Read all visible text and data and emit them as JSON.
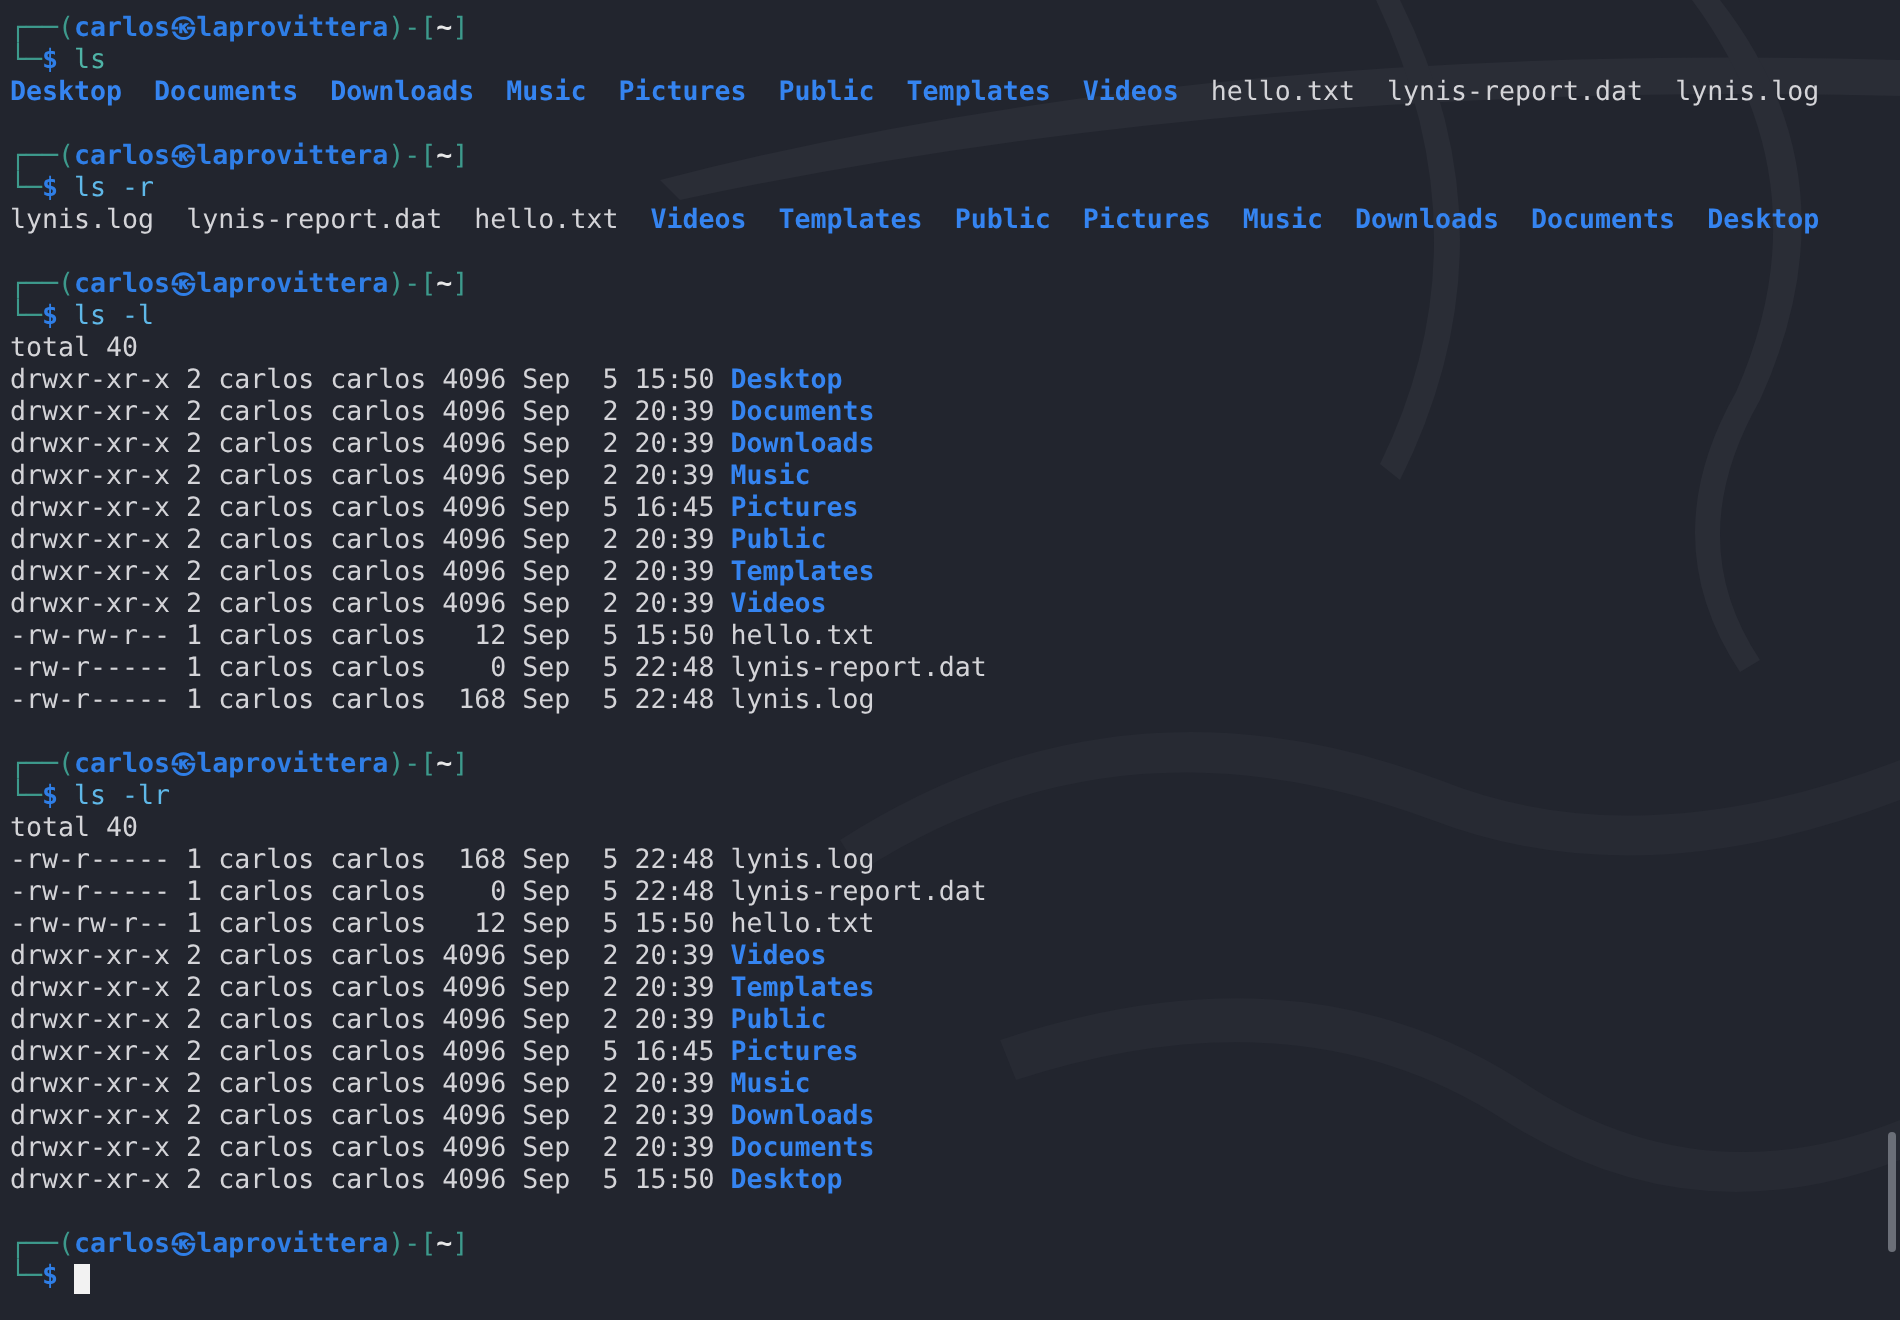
{
  "sessions": [
    {
      "prompt": {
        "open": "┌──(",
        "user": "carlos",
        "at": "㉿",
        "host": "laprovittera",
        "mid": ")-[",
        "dir": "~",
        "close": "]",
        "lead": "└─",
        "symbol": "$"
      },
      "command": "ls",
      "output": {
        "kind": "names",
        "entries": [
          {
            "name": "Desktop",
            "directory": true
          },
          {
            "name": "Documents",
            "directory": true
          },
          {
            "name": "Downloads",
            "directory": true
          },
          {
            "name": "Music",
            "directory": true
          },
          {
            "name": "Pictures",
            "directory": true
          },
          {
            "name": "Public",
            "directory": true
          },
          {
            "name": "Templates",
            "directory": true
          },
          {
            "name": "Videos",
            "directory": true
          },
          {
            "name": "hello.txt",
            "directory": false
          },
          {
            "name": "lynis-report.dat",
            "directory": false
          },
          {
            "name": "lynis.log",
            "directory": false
          }
        ]
      }
    },
    {
      "prompt": {
        "open": "┌──(",
        "user": "carlos",
        "at": "㉿",
        "host": "laprovittera",
        "mid": ")-[",
        "dir": "~",
        "close": "]",
        "lead": "└─",
        "symbol": "$"
      },
      "command": "ls -r",
      "output": {
        "kind": "names",
        "entries": [
          {
            "name": "lynis.log",
            "directory": false
          },
          {
            "name": "lynis-report.dat",
            "directory": false
          },
          {
            "name": "hello.txt",
            "directory": false
          },
          {
            "name": "Videos",
            "directory": true
          },
          {
            "name": "Templates",
            "directory": true
          },
          {
            "name": "Public",
            "directory": true
          },
          {
            "name": "Pictures",
            "directory": true
          },
          {
            "name": "Music",
            "directory": true
          },
          {
            "name": "Downloads",
            "directory": true
          },
          {
            "name": "Documents",
            "directory": true
          },
          {
            "name": "Desktop",
            "directory": true
          }
        ]
      }
    },
    {
      "prompt": {
        "open": "┌──(",
        "user": "carlos",
        "at": "㉿",
        "host": "laprovittera",
        "mid": ")-[",
        "dir": "~",
        "close": "]",
        "lead": "└─",
        "symbol": "$"
      },
      "command": "ls -l",
      "output": {
        "kind": "long",
        "total": "total 40",
        "rows": [
          {
            "perms": "drwxr-xr-x",
            "links": "2",
            "owner": "carlos",
            "group": "carlos",
            "size": "4096",
            "month": "Sep",
            "day": "5",
            "time": "15:50",
            "name": "Desktop",
            "directory": true
          },
          {
            "perms": "drwxr-xr-x",
            "links": "2",
            "owner": "carlos",
            "group": "carlos",
            "size": "4096",
            "month": "Sep",
            "day": "2",
            "time": "20:39",
            "name": "Documents",
            "directory": true
          },
          {
            "perms": "drwxr-xr-x",
            "links": "2",
            "owner": "carlos",
            "group": "carlos",
            "size": "4096",
            "month": "Sep",
            "day": "2",
            "time": "20:39",
            "name": "Downloads",
            "directory": true
          },
          {
            "perms": "drwxr-xr-x",
            "links": "2",
            "owner": "carlos",
            "group": "carlos",
            "size": "4096",
            "month": "Sep",
            "day": "2",
            "time": "20:39",
            "name": "Music",
            "directory": true
          },
          {
            "perms": "drwxr-xr-x",
            "links": "2",
            "owner": "carlos",
            "group": "carlos",
            "size": "4096",
            "month": "Sep",
            "day": "5",
            "time": "16:45",
            "name": "Pictures",
            "directory": true
          },
          {
            "perms": "drwxr-xr-x",
            "links": "2",
            "owner": "carlos",
            "group": "carlos",
            "size": "4096",
            "month": "Sep",
            "day": "2",
            "time": "20:39",
            "name": "Public",
            "directory": true
          },
          {
            "perms": "drwxr-xr-x",
            "links": "2",
            "owner": "carlos",
            "group": "carlos",
            "size": "4096",
            "month": "Sep",
            "day": "2",
            "time": "20:39",
            "name": "Templates",
            "directory": true
          },
          {
            "perms": "drwxr-xr-x",
            "links": "2",
            "owner": "carlos",
            "group": "carlos",
            "size": "4096",
            "month": "Sep",
            "day": "2",
            "time": "20:39",
            "name": "Videos",
            "directory": true
          },
          {
            "perms": "-rw-rw-r--",
            "links": "1",
            "owner": "carlos",
            "group": "carlos",
            "size": "12",
            "month": "Sep",
            "day": "5",
            "time": "15:50",
            "name": "hello.txt",
            "directory": false
          },
          {
            "perms": "-rw-r-----",
            "links": "1",
            "owner": "carlos",
            "group": "carlos",
            "size": "0",
            "month": "Sep",
            "day": "5",
            "time": "22:48",
            "name": "lynis-report.dat",
            "directory": false
          },
          {
            "perms": "-rw-r-----",
            "links": "1",
            "owner": "carlos",
            "group": "carlos",
            "size": "168",
            "month": "Sep",
            "day": "5",
            "time": "22:48",
            "name": "lynis.log",
            "directory": false
          }
        ]
      }
    },
    {
      "prompt": {
        "open": "┌──(",
        "user": "carlos",
        "at": "㉿",
        "host": "laprovittera",
        "mid": ")-[",
        "dir": "~",
        "close": "]",
        "lead": "└─",
        "symbol": "$"
      },
      "command": "ls -lr",
      "output": {
        "kind": "long",
        "total": "total 40",
        "rows": [
          {
            "perms": "-rw-r-----",
            "links": "1",
            "owner": "carlos",
            "group": "carlos",
            "size": "168",
            "month": "Sep",
            "day": "5",
            "time": "22:48",
            "name": "lynis.log",
            "directory": false
          },
          {
            "perms": "-rw-r-----",
            "links": "1",
            "owner": "carlos",
            "group": "carlos",
            "size": "0",
            "month": "Sep",
            "day": "5",
            "time": "22:48",
            "name": "lynis-report.dat",
            "directory": false
          },
          {
            "perms": "-rw-rw-r--",
            "links": "1",
            "owner": "carlos",
            "group": "carlos",
            "size": "12",
            "month": "Sep",
            "day": "5",
            "time": "15:50",
            "name": "hello.txt",
            "directory": false
          },
          {
            "perms": "drwxr-xr-x",
            "links": "2",
            "owner": "carlos",
            "group": "carlos",
            "size": "4096",
            "month": "Sep",
            "day": "2",
            "time": "20:39",
            "name": "Videos",
            "directory": true
          },
          {
            "perms": "drwxr-xr-x",
            "links": "2",
            "owner": "carlos",
            "group": "carlos",
            "size": "4096",
            "month": "Sep",
            "day": "2",
            "time": "20:39",
            "name": "Templates",
            "directory": true
          },
          {
            "perms": "drwxr-xr-x",
            "links": "2",
            "owner": "carlos",
            "group": "carlos",
            "size": "4096",
            "month": "Sep",
            "day": "2",
            "time": "20:39",
            "name": "Public",
            "directory": true
          },
          {
            "perms": "drwxr-xr-x",
            "links": "2",
            "owner": "carlos",
            "group": "carlos",
            "size": "4096",
            "month": "Sep",
            "day": "5",
            "time": "16:45",
            "name": "Pictures",
            "directory": true
          },
          {
            "perms": "drwxr-xr-x",
            "links": "2",
            "owner": "carlos",
            "group": "carlos",
            "size": "4096",
            "month": "Sep",
            "day": "2",
            "time": "20:39",
            "name": "Music",
            "directory": true
          },
          {
            "perms": "drwxr-xr-x",
            "links": "2",
            "owner": "carlos",
            "group": "carlos",
            "size": "4096",
            "month": "Sep",
            "day": "2",
            "time": "20:39",
            "name": "Downloads",
            "directory": true
          },
          {
            "perms": "drwxr-xr-x",
            "links": "2",
            "owner": "carlos",
            "group": "carlos",
            "size": "4096",
            "month": "Sep",
            "day": "2",
            "time": "20:39",
            "name": "Documents",
            "directory": true
          },
          {
            "perms": "drwxr-xr-x",
            "links": "2",
            "owner": "carlos",
            "group": "carlos",
            "size": "4096",
            "month": "Sep",
            "day": "5",
            "time": "15:50",
            "name": "Desktop",
            "directory": true
          }
        ]
      }
    }
  ],
  "current": {
    "prompt": {
      "open": "┌──(",
      "user": "carlos",
      "at": "㉿",
      "host": "laprovittera",
      "mid": ")-[",
      "dir": "~",
      "close": "]",
      "lead": "└─",
      "symbol": "$"
    },
    "cursor": true
  }
}
